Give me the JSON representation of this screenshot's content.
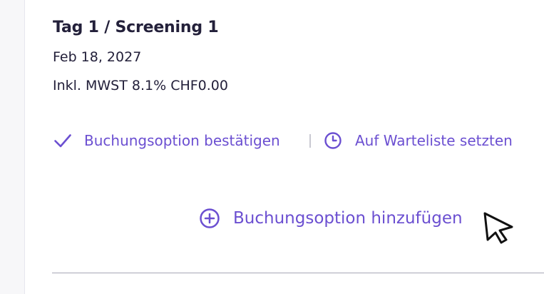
{
  "session": {
    "title": "Tag 1 / Screening 1",
    "date": "Feb 18, 2027",
    "tax_note": "Inkl. MWST 8.1% CHF0.00"
  },
  "actions": {
    "confirm_label": "Buchungsoption bestätigen",
    "waitlist_label": "Auf Warteliste setzten",
    "add_label": "Buchungsoption hinzufügen"
  },
  "colors": {
    "accent": "#6b4fd1",
    "text": "#23203a",
    "divider": "#a6a6b5"
  },
  "icons": {
    "confirm": "check-icon",
    "waitlist": "clock-icon",
    "add": "plus-circle-icon",
    "pointer": "mouse-pointer-icon"
  }
}
